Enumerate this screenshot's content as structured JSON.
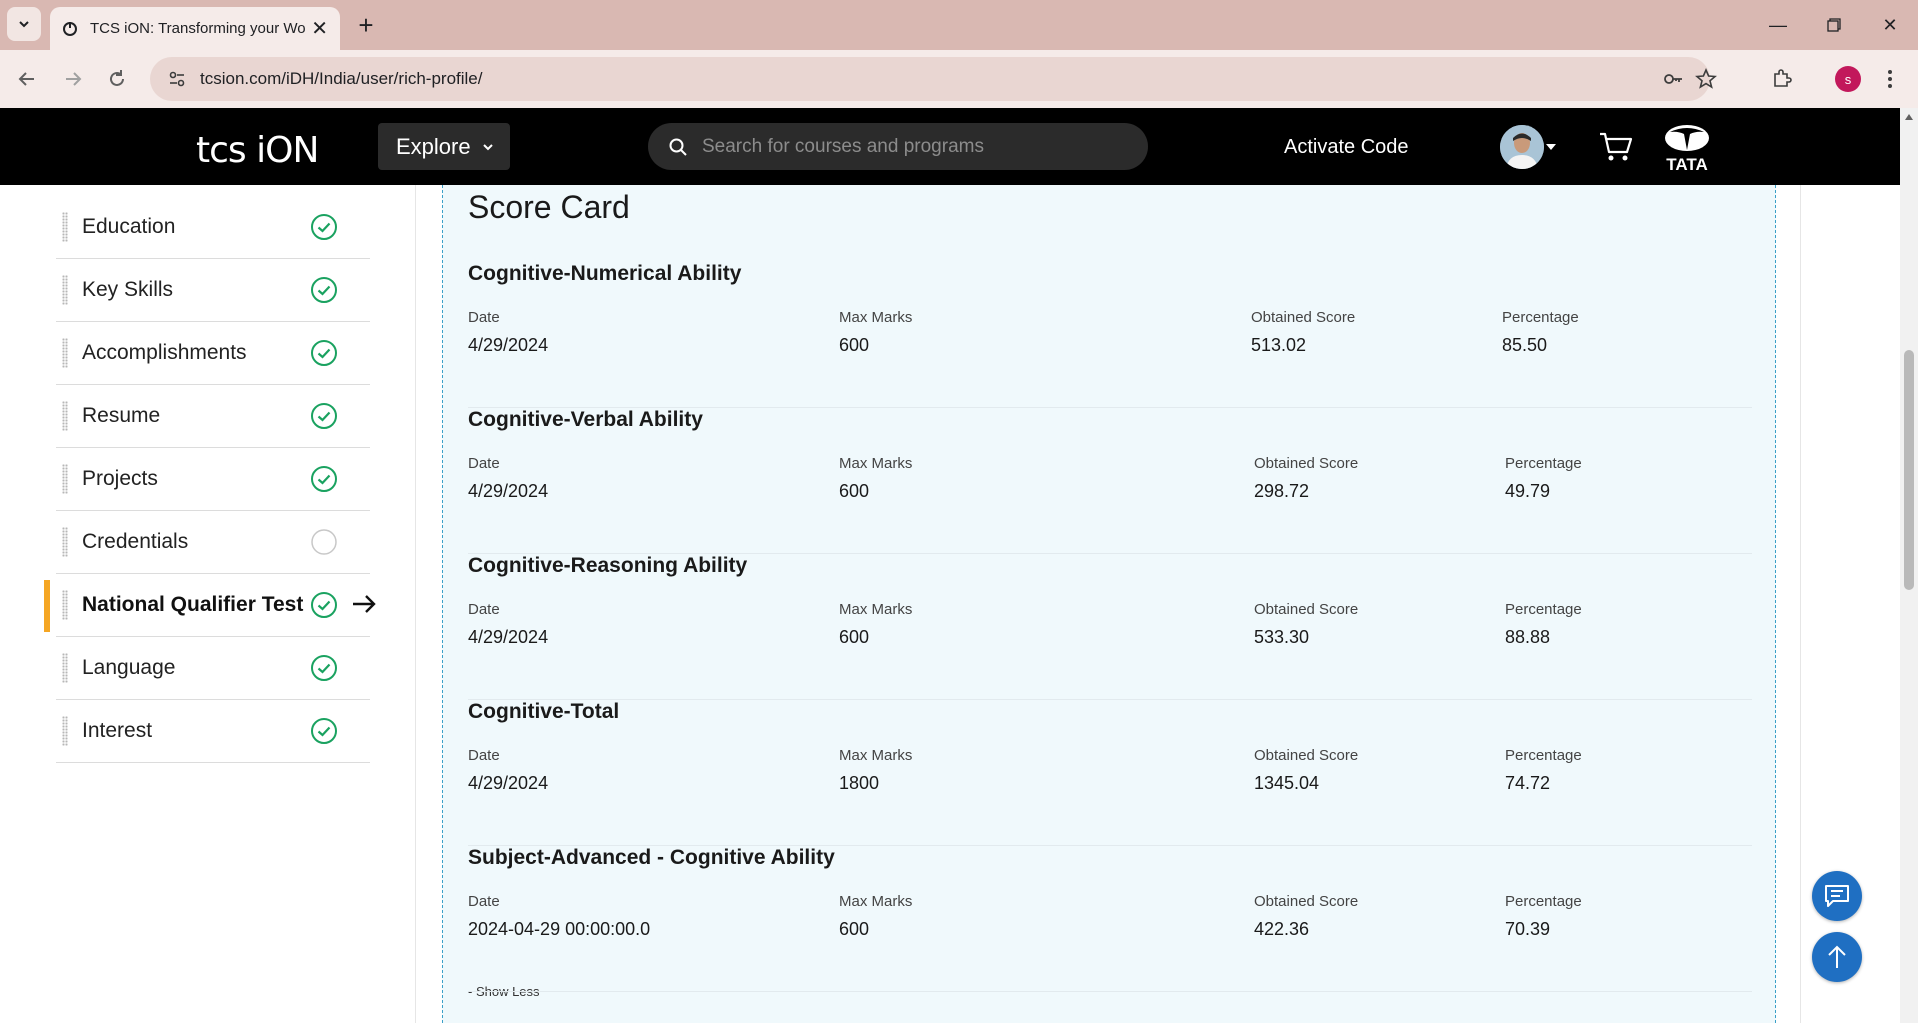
{
  "browser": {
    "tab_title": "TCS iON: Transforming your Wo",
    "url": "tcsion.com/iDH/India/user/rich-profile/",
    "profile_initial": "s"
  },
  "header": {
    "logo_text": "tcs iON",
    "explore_label": "Explore",
    "search_placeholder": "Search for courses and programs",
    "activate_label": "Activate Code"
  },
  "sidebar": {
    "items": [
      {
        "label": "Education",
        "status": "complete"
      },
      {
        "label": "Key Skills",
        "status": "complete"
      },
      {
        "label": "Accomplishments",
        "status": "complete"
      },
      {
        "label": "Resume",
        "status": "complete"
      },
      {
        "label": "Projects",
        "status": "complete"
      },
      {
        "label": "Credentials",
        "status": "incomplete"
      },
      {
        "label": "National Qualifier Test",
        "status": "complete",
        "active": true
      },
      {
        "label": "Language",
        "status": "complete"
      },
      {
        "label": "Interest",
        "status": "complete"
      }
    ]
  },
  "scorecard": {
    "title": "Score Card",
    "col_date": "Date",
    "col_max": "Max Marks",
    "col_obtained": "Obtained Score",
    "col_percentage": "Percentage",
    "sections": [
      {
        "name": "Cognitive-Numerical Ability",
        "date": "4/29/2024",
        "max": "600",
        "obtained": "513.02",
        "percentage": "85.50"
      },
      {
        "name": "Cognitive-Verbal Ability",
        "date": "4/29/2024",
        "max": "600",
        "obtained": "298.72",
        "percentage": "49.79"
      },
      {
        "name": "Cognitive-Reasoning Ability",
        "date": "4/29/2024",
        "max": "600",
        "obtained": "533.30",
        "percentage": "88.88"
      },
      {
        "name": "Cognitive-Total",
        "date": "4/29/2024",
        "max": "1800",
        "obtained": "1345.04",
        "percentage": "74.72"
      },
      {
        "name": "Subject-Advanced - Cognitive Ability",
        "date": "2024-04-29 00:00:00.0",
        "max": "600",
        "obtained": "422.36",
        "percentage": "70.39"
      }
    ],
    "show_less": "- Show Less"
  },
  "colors": {
    "accent_green": "#1aa260",
    "active_bar": "#f5a623",
    "fab_blue": "#1f6fc2"
  }
}
